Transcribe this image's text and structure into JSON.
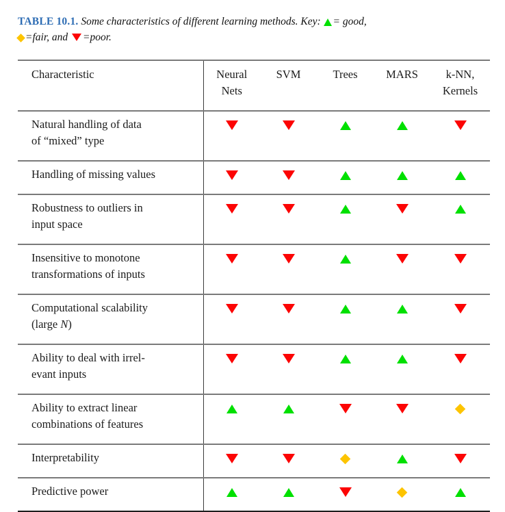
{
  "caption": {
    "table_number": "TABLE 10.1.",
    "text_before_key": "Some characteristics of different learning methods. Key:",
    "key_good_symbol": "up-triangle",
    "key_good_text": "= good,",
    "key_fair_symbol": "diamond",
    "key_fair_text": "=fair, and",
    "key_poor_symbol": "down-triangle",
    "key_poor_text": "=poor."
  },
  "colors": {
    "good": "#00e000",
    "fair": "#fdc400",
    "poor": "#fc0404",
    "table_number": "#2e6db4",
    "rule_gray": "#7a7a7a",
    "rule_dark": "#1d1d1d"
  },
  "table": {
    "headers": [
      {
        "label": "Characteristic",
        "line2": ""
      },
      {
        "label": "Neural",
        "line2": "Nets"
      },
      {
        "label": "SVM",
        "line2": ""
      },
      {
        "label": "Trees",
        "line2": ""
      },
      {
        "label": "MARS",
        "line2": ""
      },
      {
        "label": "k-NN,",
        "line2": "Kernels"
      }
    ],
    "rows": [
      {
        "characteristic_line1": "Natural handling of data",
        "characteristic_line2": "of “mixed” type",
        "ratings": [
          "poor",
          "poor",
          "good",
          "good",
          "poor"
        ]
      },
      {
        "characteristic_line1": "Handling of missing values",
        "characteristic_line2": "",
        "ratings": [
          "poor",
          "poor",
          "good",
          "good",
          "good"
        ]
      },
      {
        "characteristic_line1": "Robustness to outliers in",
        "characteristic_line2": "input space",
        "ratings": [
          "poor",
          "poor",
          "good",
          "poor",
          "good"
        ]
      },
      {
        "characteristic_line1": "Insensitive to monotone",
        "characteristic_line2": "transformations of inputs",
        "ratings": [
          "poor",
          "poor",
          "good",
          "poor",
          "poor"
        ]
      },
      {
        "characteristic_line1": "Computational scalability",
        "characteristic_line2": "(large N)",
        "ratings": [
          "poor",
          "poor",
          "good",
          "good",
          "poor"
        ]
      },
      {
        "characteristic_line1": "Ability to deal with irrel-",
        "characteristic_line2": "evant inputs",
        "ratings": [
          "poor",
          "poor",
          "good",
          "good",
          "poor"
        ]
      },
      {
        "characteristic_line1": "Ability to extract linear",
        "characteristic_line2": "combinations of features",
        "ratings": [
          "good",
          "good",
          "poor",
          "poor",
          "fair"
        ]
      },
      {
        "characteristic_line1": "Interpretability",
        "characteristic_line2": "",
        "ratings": [
          "poor",
          "poor",
          "fair",
          "good",
          "poor"
        ]
      },
      {
        "characteristic_line1": "Predictive power",
        "characteristic_line2": "",
        "ratings": [
          "good",
          "good",
          "poor",
          "fair",
          "good"
        ]
      }
    ]
  }
}
